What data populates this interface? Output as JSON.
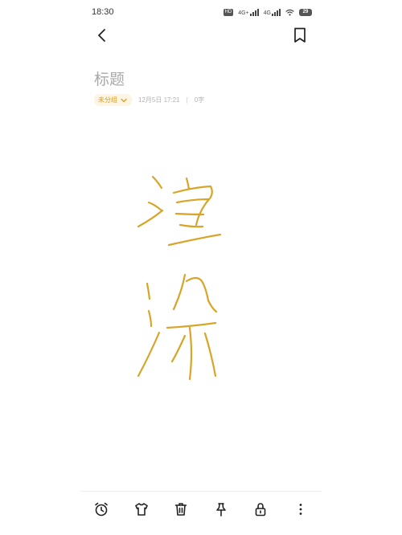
{
  "status_bar": {
    "time": "18:30",
    "hd_label": "HD",
    "net1": "4G+",
    "net2": "4G",
    "battery": "29"
  },
  "note": {
    "title_placeholder": "标题",
    "group_label": "未分组",
    "datetime": "12月5日 17:21",
    "separator": "|",
    "word_count": "0字"
  },
  "drawing": {
    "stroke_color": "#d8a528"
  },
  "toolbar": {
    "icons": [
      "alarm-clock-icon",
      "shirt-icon",
      "trash-icon",
      "pin-icon",
      "lock-icon",
      "more-vertical-icon"
    ]
  },
  "colors": {
    "accent": "#d69f24",
    "title_gray": "#a9a9a9",
    "meta_gray": "#b3b3b3"
  }
}
